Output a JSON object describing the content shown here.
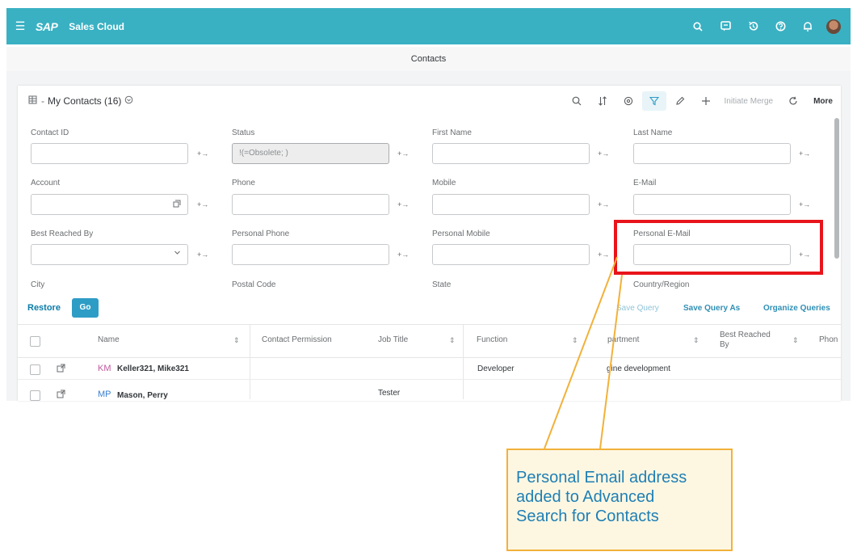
{
  "shell": {
    "brand": "SAP",
    "app_title": "Sales Cloud"
  },
  "page": {
    "title": "Contacts"
  },
  "view": {
    "title": "My Contacts (16)"
  },
  "toolbar": {
    "initiate_merge": "Initiate Merge",
    "more": "More"
  },
  "filters": {
    "contact_id": {
      "label": "Contact ID",
      "value": "",
      "op": "+→"
    },
    "status": {
      "label": "Status",
      "value": "!(=Obsolete; )",
      "op": "+→"
    },
    "first_name": {
      "label": "First Name",
      "value": "",
      "op": "+→"
    },
    "last_name": {
      "label": "Last Name",
      "value": "",
      "op": "+→"
    },
    "account": {
      "label": "Account",
      "value": "",
      "op": "+→"
    },
    "phone": {
      "label": "Phone",
      "value": "",
      "op": "+→"
    },
    "mobile": {
      "label": "Mobile",
      "value": "",
      "op": "+→"
    },
    "email": {
      "label": "E-Mail",
      "value": "",
      "op": "+→"
    },
    "best_reached_by": {
      "label": "Best Reached By",
      "value": "",
      "op": "+→"
    },
    "personal_phone": {
      "label": "Personal Phone",
      "value": "",
      "op": "+→"
    },
    "personal_mobile": {
      "label": "Personal Mobile",
      "value": "",
      "op": "+→"
    },
    "personal_email": {
      "label": "Personal E-Mail",
      "value": "",
      "op": "+→"
    },
    "city": {
      "label": "City"
    },
    "postal_code": {
      "label": "Postal Code"
    },
    "state": {
      "label": "State"
    },
    "country": {
      "label": "Country/Region"
    }
  },
  "actions": {
    "restore": "Restore",
    "go": "Go",
    "save_query": "Save Query",
    "save_query_as": "Save Query As",
    "organize_queries": "Organize Queries"
  },
  "table": {
    "columns": {
      "name": "Name",
      "contact_permission": "Contact Permission",
      "job_title": "Job Title",
      "function": "Function",
      "department": "partment",
      "best_reached_by_1": "Best Reached",
      "best_reached_by_2": "By",
      "phone": "Phon"
    },
    "rows": [
      {
        "initials": "KM",
        "name": "Keller321, Mike321",
        "job_title": "",
        "function": "Developer",
        "department": "gine development",
        "initials_color": "#c05aa0"
      },
      {
        "initials": "MP",
        "name": "Mason, Perry",
        "job_title": "Tester",
        "function": "",
        "department": "",
        "initials_color": "#3a7fd0"
      }
    ]
  },
  "annotation": {
    "callout_lines": [
      "Personal Email address",
      "added to Advanced",
      "Search for Contacts"
    ],
    "highlight_color": "#e8141b",
    "callout_border": "#f2b13a",
    "callout_text_color": "#1f7fb4"
  },
  "colors": {
    "shell": "#39b1c3",
    "accent": "#2e9dc6"
  }
}
